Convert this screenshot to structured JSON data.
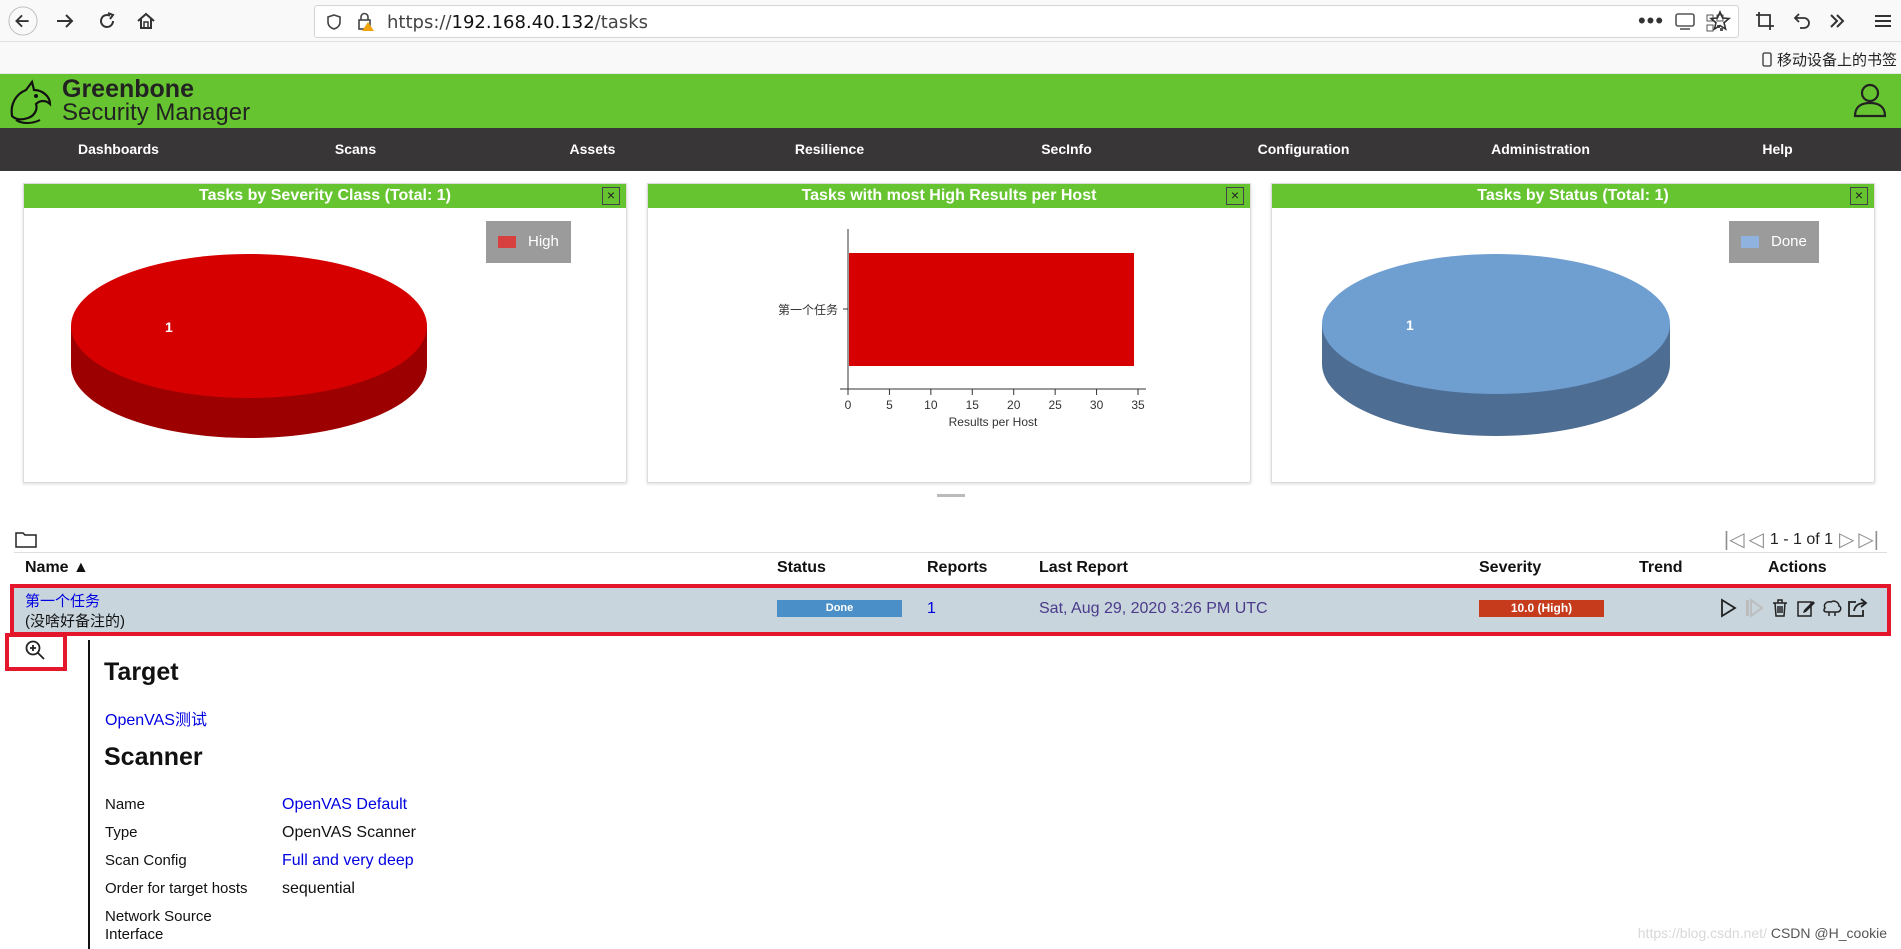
{
  "browser": {
    "url_prefix": "https://",
    "url_host": "192.168.40.132",
    "url_path": "/tasks",
    "mobile_bookmarks": "移动设备上的书签"
  },
  "app": {
    "title": "Greenbone",
    "subtitle": "Security Manager"
  },
  "menu": [
    "Dashboards",
    "Scans",
    "Assets",
    "Resilience",
    "SecInfo",
    "Configuration",
    "Administration",
    "Help"
  ],
  "dashboards": {
    "severity": {
      "title": "Tasks by Severity Class (Total: 1)",
      "legend": "High",
      "slice_label": "1",
      "color": "#d60000"
    },
    "high_results": {
      "title": "Tasks with most High Results per Host"
    },
    "status": {
      "title": "Tasks by Status (Total: 1)",
      "legend": "Done",
      "slice_label": "1",
      "color": "#6f9ed1"
    }
  },
  "chart_data": [
    {
      "type": "pie",
      "title": "Tasks by Severity Class (Total: 1)",
      "categories": [
        "High"
      ],
      "values": [
        1
      ]
    },
    {
      "type": "bar",
      "title": "Tasks with most High Results per Host",
      "categories": [
        "第一个任务"
      ],
      "values": [
        34.4
      ],
      "xlabel": "Results per Host",
      "xlim": [
        0,
        35
      ],
      "ticks": [
        "0",
        "5",
        "10",
        "15",
        "20",
        "25",
        "30",
        "35"
      ]
    },
    {
      "type": "pie",
      "title": "Tasks by Status (Total: 1)",
      "categories": [
        "Done"
      ],
      "values": [
        1
      ]
    }
  ],
  "pagination": "1 - 1 of 1",
  "table": {
    "headers": {
      "name": "Name ▲",
      "status": "Status",
      "reports": "Reports",
      "last_report": "Last Report",
      "severity": "Severity",
      "trend": "Trend",
      "actions": "Actions"
    },
    "row": {
      "name": "第一个任务",
      "comment": "(没啥好备注的)",
      "status": "Done",
      "reports": "1",
      "last_report": "Sat, Aug 29, 2020 3:26 PM UTC",
      "severity": "10.0 (High)"
    }
  },
  "details": {
    "target_heading": "Target",
    "target_link": "OpenVAS测试",
    "scanner_heading": "Scanner",
    "fields": [
      {
        "label": "Name",
        "value": "OpenVAS Default"
      },
      {
        "label": "Type",
        "value": "OpenVAS Scanner"
      },
      {
        "label": "Scan Config",
        "value": "Full and very deep"
      },
      {
        "label": "Order for target hosts",
        "value": "sequential"
      },
      {
        "label": "Network Source Interface",
        "value": ""
      }
    ]
  },
  "watermark": {
    "faint": "https://blog.csdn.net/",
    "label": "CSDN @H_cookie"
  }
}
